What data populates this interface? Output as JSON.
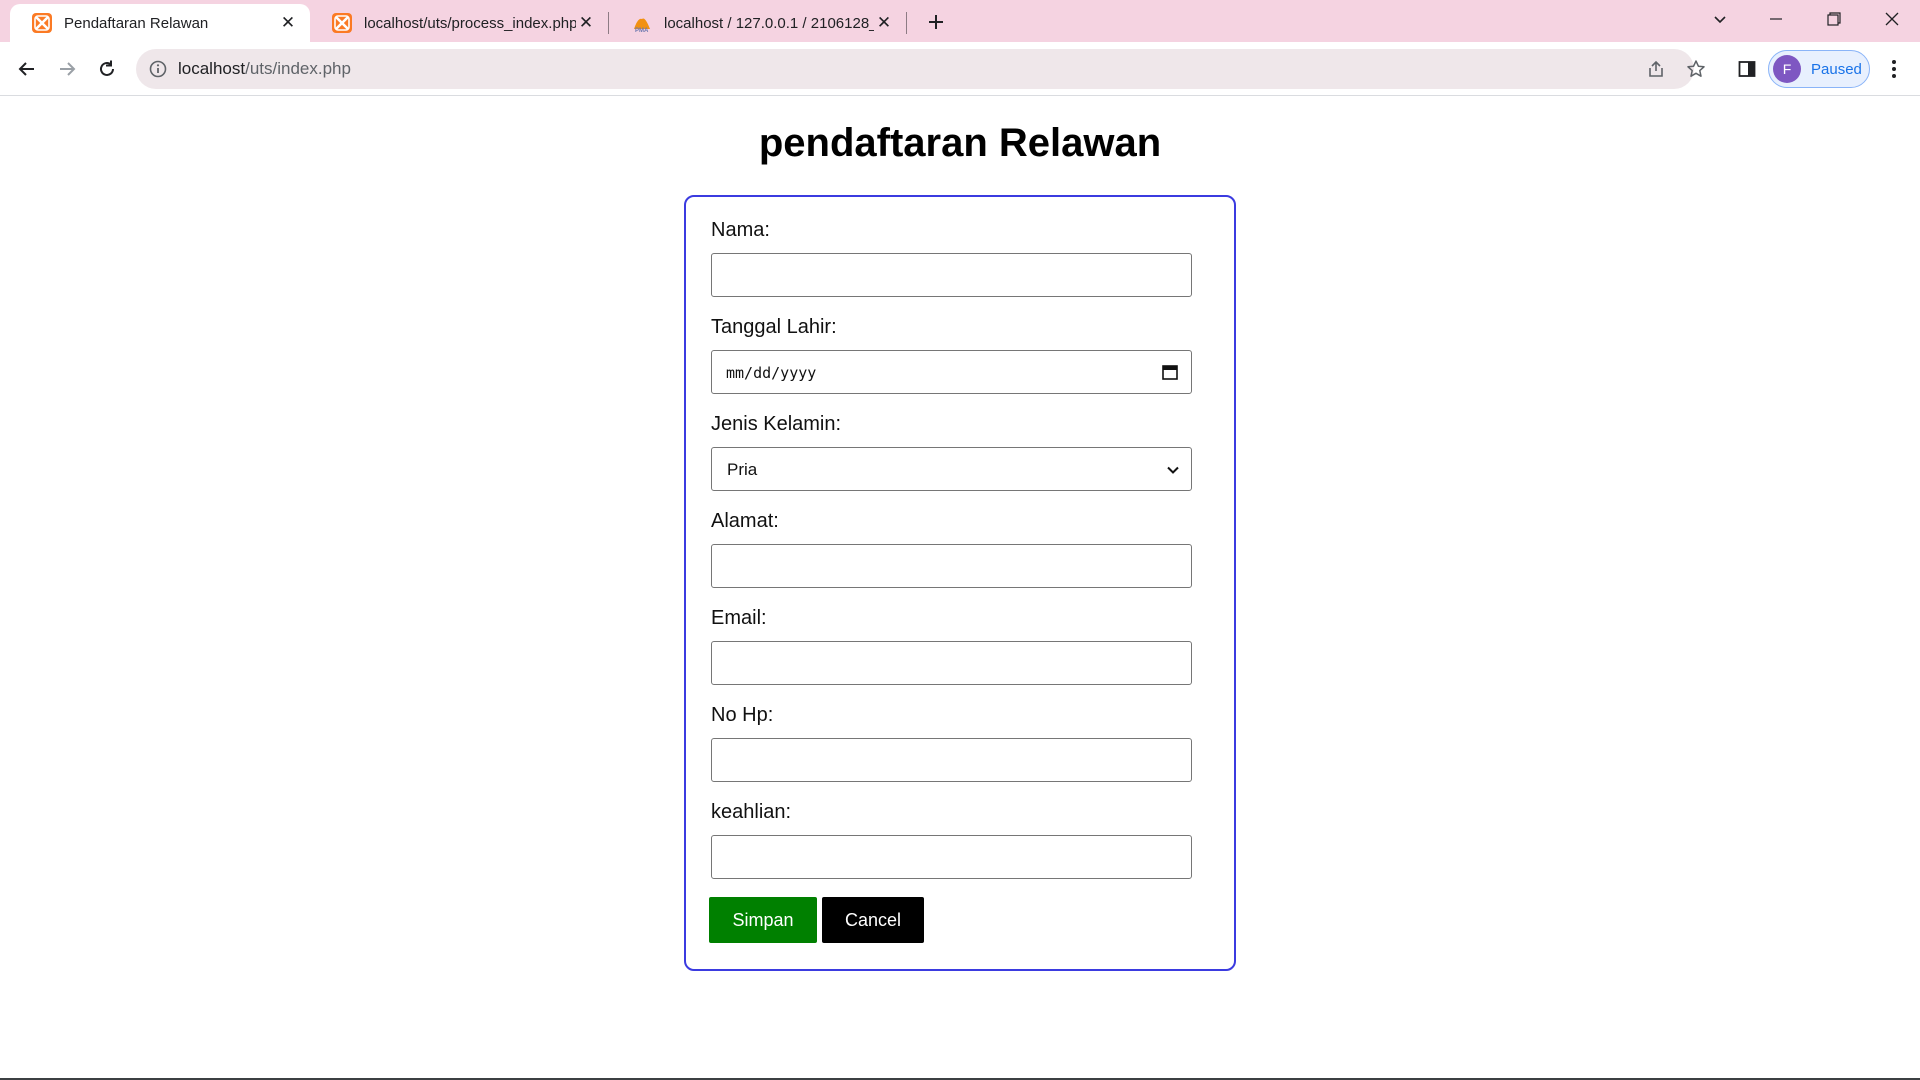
{
  "browser": {
    "tabs": [
      {
        "title": "Pendaftaran Relawan",
        "active": true,
        "icon": "xampp-icon"
      },
      {
        "title": "localhost/uts/process_index.php",
        "active": false,
        "icon": "xampp-icon"
      },
      {
        "title": "localhost / 127.0.0.1 / 2106128_",
        "active": false,
        "icon": "phpmyadmin-icon"
      }
    ],
    "url_host": "localhost",
    "url_path": "/uts/index.php",
    "profile": {
      "initial": "F",
      "label": "Paused"
    }
  },
  "form": {
    "title": "pendaftaran Relawan",
    "fields": [
      {
        "label": "Nama:",
        "type": "text",
        "value": ""
      },
      {
        "label": "Tanggal Lahir:",
        "type": "date",
        "placeholder": "mm/dd/yyyy"
      },
      {
        "label": "Jenis Kelamin:",
        "type": "select",
        "value": "Pria"
      },
      {
        "label": "Alamat:",
        "type": "text",
        "value": ""
      },
      {
        "label": "Email:",
        "type": "text",
        "value": ""
      },
      {
        "label": "No Hp:",
        "type": "text",
        "value": ""
      },
      {
        "label": "keahlian:",
        "type": "text",
        "value": ""
      }
    ],
    "save_label": "Simpan",
    "cancel_label": "Cancel"
  },
  "colors": {
    "tabstrip": "#f5d3e1",
    "card_border": "#3b3be0",
    "save_button": "#008000",
    "cancel_button": "#000000"
  }
}
